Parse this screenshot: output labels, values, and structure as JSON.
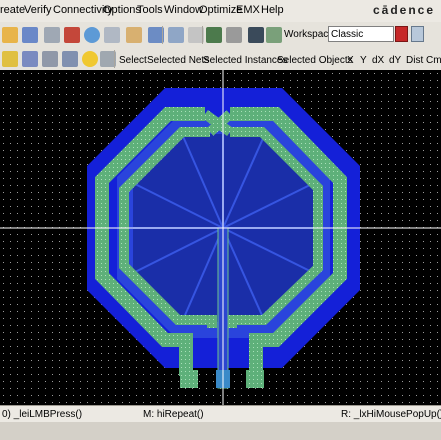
{
  "menubar": {
    "items": [
      "reate",
      "Verify",
      "Connectivity",
      "Options",
      "Tools",
      "Window",
      "Optimize",
      "EMX",
      "Help"
    ],
    "brand": "cādence"
  },
  "toolbar1": {
    "workspace_label": "Workspace:",
    "workspace_value": "Classic"
  },
  "toolbar2": {
    "items": [
      "Select",
      "Selected Nets",
      "Selected Instances",
      "Selected Objects",
      "X",
      "Y",
      "dX",
      "dY",
      "Dist",
      "Cmd"
    ]
  },
  "statusbar": {
    "left": "0) _leiLMBPress()",
    "middle": "M: hiRepeat()",
    "right": "R: _lxHiMousePopUp()"
  },
  "colors": {
    "canvas_bg": "#000000",
    "outer_metal": "#1420d8",
    "inner_octagon": "#2a44dc",
    "coil_trace": "#6cc48a",
    "crosshair": "#ffffff",
    "workspace_button": "#c62828"
  }
}
